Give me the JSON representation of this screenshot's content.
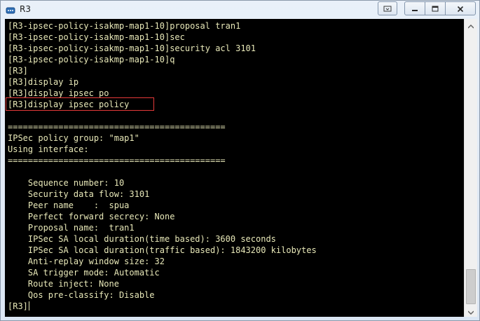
{
  "window": {
    "title": "R3",
    "app_icon": "router-terminal-icon",
    "controls": {
      "options_icon": "chevron-down-icon",
      "minimize_icon": "minimize-icon",
      "maximize_icon": "maximize-icon",
      "close_icon": "close-icon"
    }
  },
  "terminal": {
    "text_color": "#e8e8b8",
    "background": "#000000",
    "highlight_color": "#e53a3a",
    "lines": [
      "[R3-ipsec-policy-isakmp-map1-10]proposal tran1",
      "[R3-ipsec-policy-isakmp-map1-10]sec",
      "[R3-ipsec-policy-isakmp-map1-10]security acl 3101",
      "[R3-ipsec-policy-isakmp-map1-10]q",
      "[R3]",
      "[R3]display ip",
      "[R3]display ipsec po",
      "[R3]display ipsec policy",
      "",
      "===========================================",
      "IPSec policy group: \"map1\"",
      "Using interface:",
      "===========================================",
      "",
      "    Sequence number: 10",
      "    Security data flow: 3101",
      "    Peer name    :  spua",
      "    Perfect forward secrecy: None",
      "    Proposal name:  tran1",
      "    IPSec SA local duration(time based): 3600 seconds",
      "    IPSec SA local duration(traffic based): 1843200 kilobytes",
      "    Anti-replay window size: 32",
      "    SA trigger mode: Automatic",
      "    Route inject: None",
      "    Qos pre-classify: Disable",
      "[R3]"
    ]
  },
  "scrollbar": {
    "up_icon": "scroll-up-arrow-icon",
    "down_icon": "scroll-down-arrow-icon",
    "position": 0.97
  }
}
